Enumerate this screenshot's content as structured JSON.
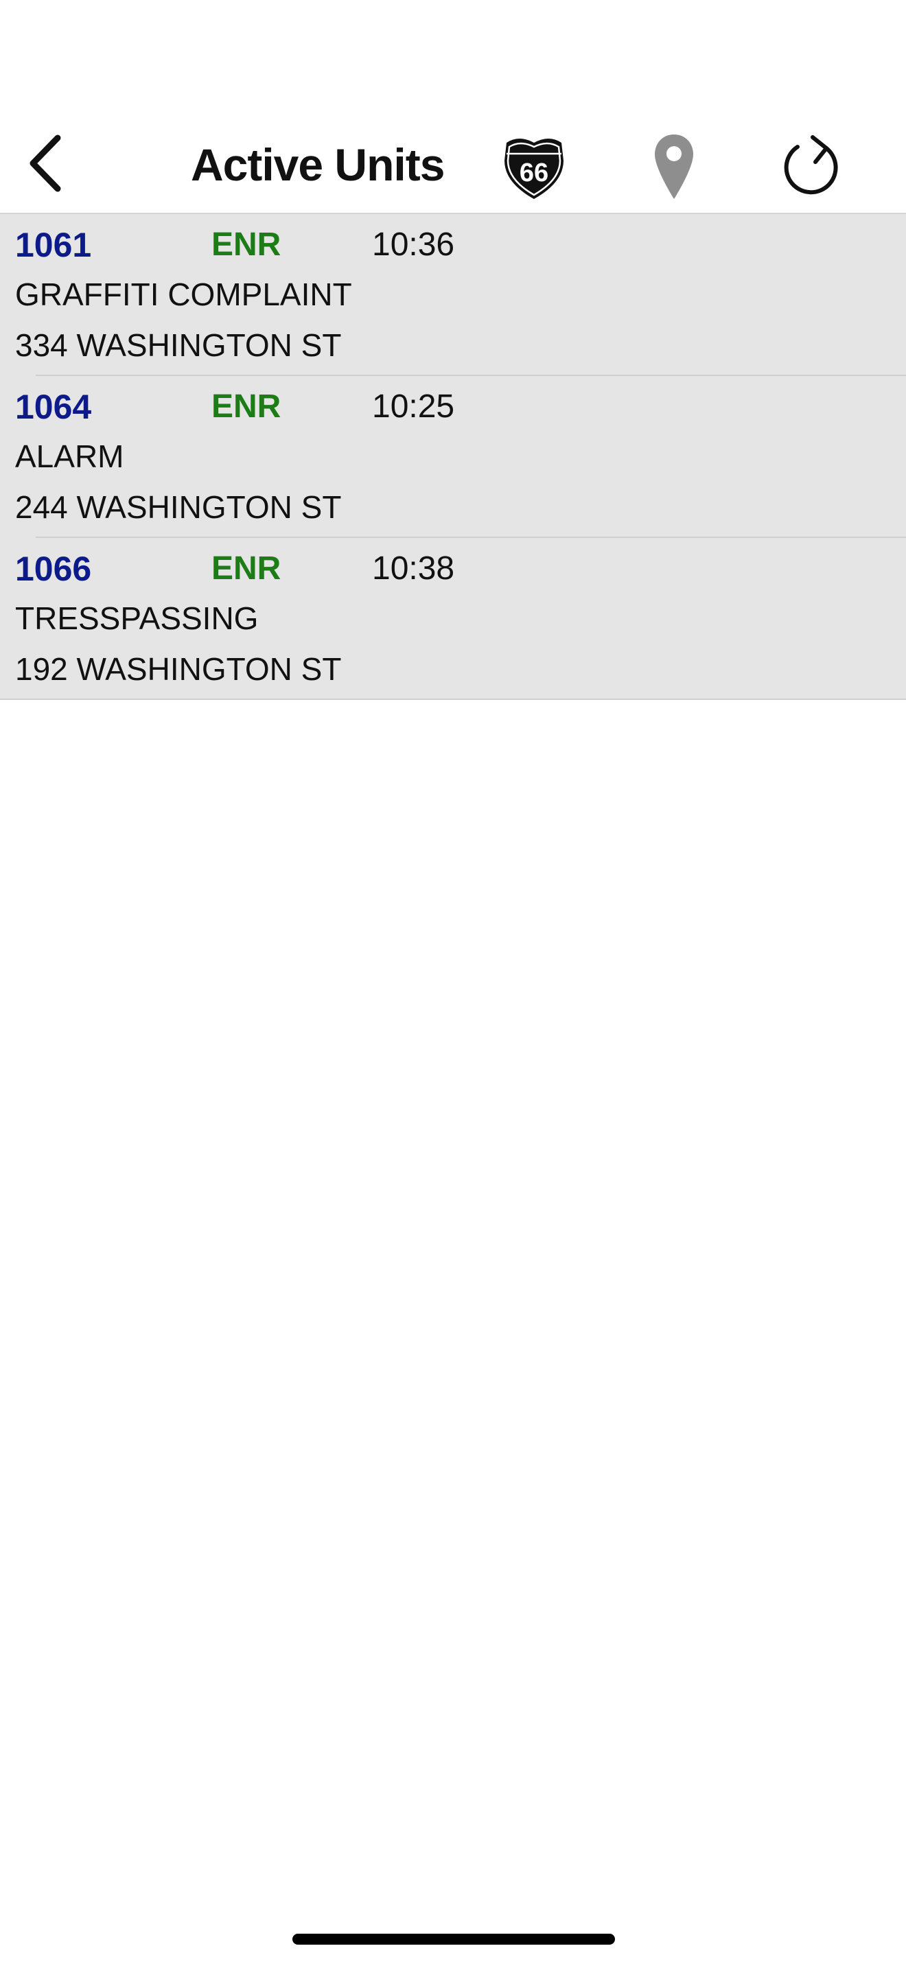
{
  "header": {
    "title": "Active Units",
    "route_shield_text": "66"
  },
  "units": [
    {
      "id": "1061",
      "status": "ENR",
      "time": "10:36",
      "call_type": "GRAFFITI COMPLAINT",
      "address": "334 WASHINGTON ST"
    },
    {
      "id": "1064",
      "status": "ENR",
      "time": "10:25",
      "call_type": "ALARM",
      "address": "244 WASHINGTON ST"
    },
    {
      "id": "1066",
      "status": "ENR",
      "time": "10:38",
      "call_type": "TRESSPASSING",
      "address": "192 WASHINGTON ST"
    }
  ],
  "icons": {
    "back": "chevron-left-icon",
    "route": "route-66-shield-icon",
    "location": "map-pin-icon",
    "refresh": "refresh-icon"
  },
  "colors": {
    "unit_id": "#0d1a8a",
    "status": "#1c7d16",
    "list_background": "#e5e5e5",
    "pin": "#8e8e8e"
  }
}
